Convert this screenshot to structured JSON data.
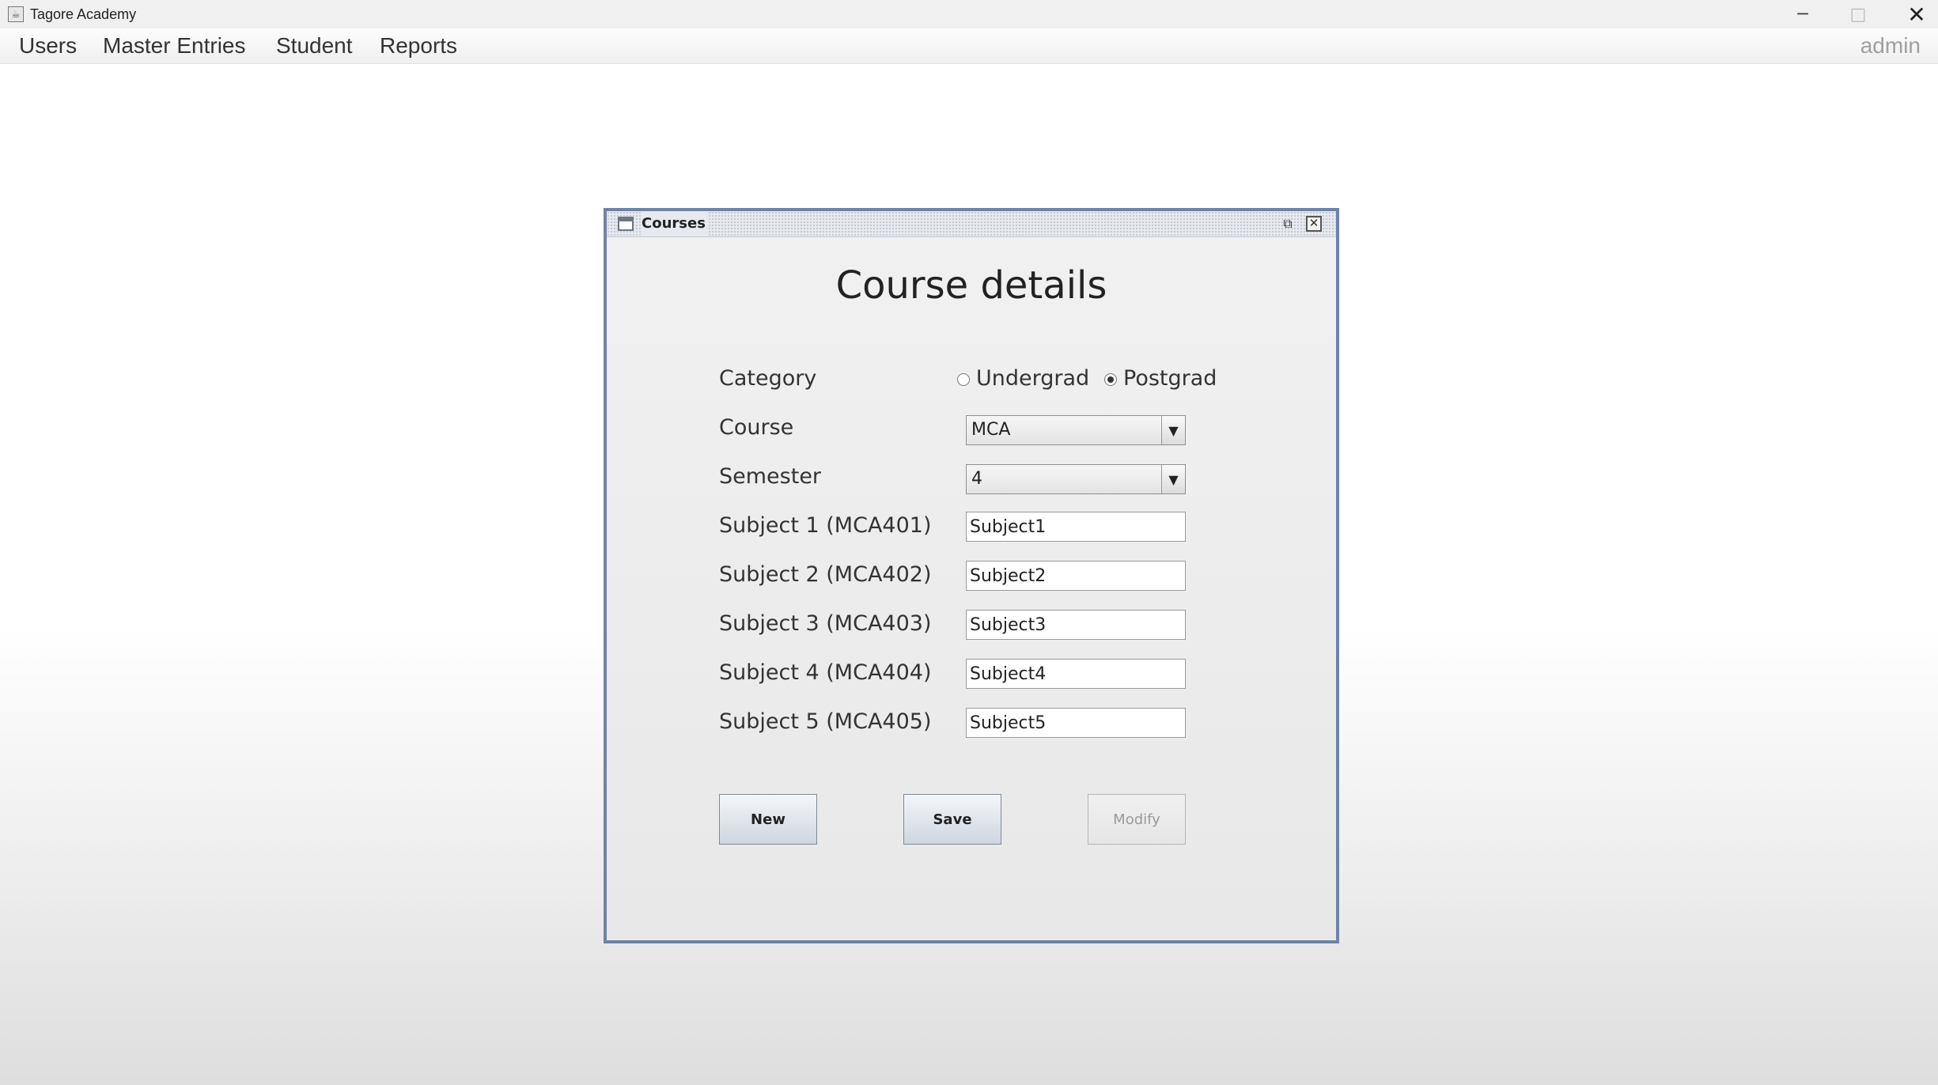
{
  "app": {
    "title": "Tagore Academy",
    "icon": "java-cup-icon"
  },
  "window_controls": {
    "minimize": "─",
    "maximize": "□",
    "close": "✕"
  },
  "menubar": {
    "items": [
      {
        "label": "Users"
      },
      {
        "label": "Master Entries"
      },
      {
        "label": "Student"
      },
      {
        "label": "Reports"
      }
    ],
    "user": "admin"
  },
  "frame": {
    "title": "Courses",
    "icon": "window-icon",
    "restore_glyph": "⧉",
    "close_glyph": "✕"
  },
  "form": {
    "heading": "Course details",
    "category": {
      "label": "Category",
      "options": [
        {
          "label": "Undergrad",
          "selected": false
        },
        {
          "label": "Postgrad",
          "selected": true
        }
      ]
    },
    "course": {
      "label": "Course",
      "value": "MCA"
    },
    "semester": {
      "label": "Semester",
      "value": "4"
    },
    "subjects": [
      {
        "label": "Subject 1 (MCA401)",
        "value": "Subject1"
      },
      {
        "label": "Subject 2 (MCA402)",
        "value": "Subject2"
      },
      {
        "label": "Subject 3 (MCA403)",
        "value": "Subject3"
      },
      {
        "label": "Subject 4 (MCA404)",
        "value": "Subject4"
      },
      {
        "label": "Subject 5 (MCA405)",
        "value": "Subject5"
      }
    ],
    "buttons": {
      "new": "New",
      "save": "Save",
      "modify": "Modify",
      "modify_enabled": false
    }
  },
  "colors": {
    "frame_border": "#6d84a8",
    "disabled_text": "#9a9a9a"
  }
}
